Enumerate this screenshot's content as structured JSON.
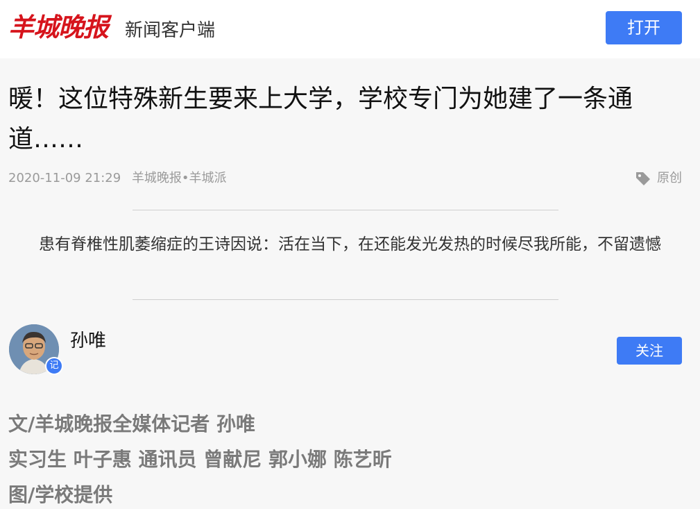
{
  "header": {
    "logo_text": "羊城晚报",
    "subtitle": "新闻客户端",
    "open_label": "打开"
  },
  "article": {
    "title": "暖！这位特殊新生要来上大学，学校专门为她建了一条通道……",
    "date": "2020-11-09 21:29",
    "source": "羊城晚报•羊城派",
    "origin_label": "原创",
    "summary": "患有脊椎性肌萎缩症的王诗因说：活在当下，在还能发光发热的时候尽我所能，不留遗憾"
  },
  "author": {
    "name": "孙唯",
    "badge": "记",
    "follow_label": "关注"
  },
  "credits": [
    "文/羊城晚报全媒体记者 孙唯",
    "实习生 叶子惠 通讯员 曾献尼 郭小娜 陈艺昕",
    "图/学校提供"
  ],
  "colors": {
    "brand_red": "#d6141c",
    "accent_blue": "#3e7bf5"
  }
}
